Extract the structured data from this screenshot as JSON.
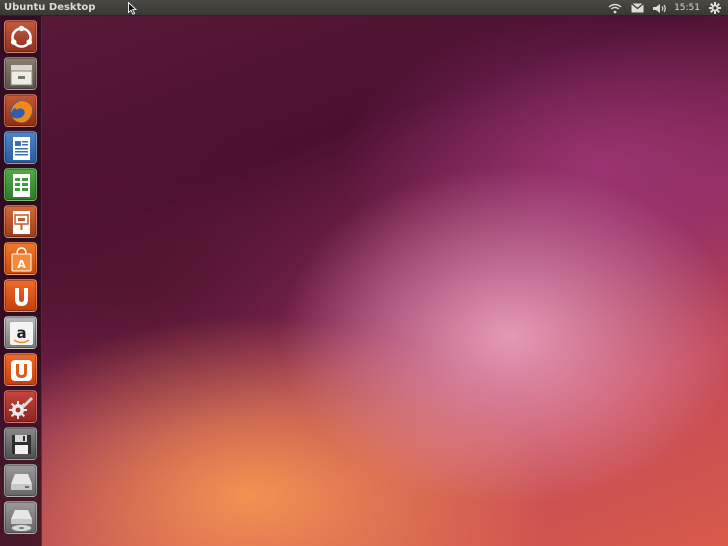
{
  "top_panel": {
    "title": "Ubuntu Desktop",
    "clock": "15:51",
    "indicators": [
      "wifi-icon",
      "mail-icon",
      "volume-icon",
      "gear-icon"
    ]
  },
  "launcher": {
    "items": [
      {
        "name": "dash-home",
        "icon": "ubuntu-logo-icon",
        "color": "#b0452f"
      },
      {
        "name": "files",
        "icon": "file-cabinet-icon",
        "color": "#7b6f63"
      },
      {
        "name": "firefox",
        "icon": "firefox-icon",
        "color": "#c0502a"
      },
      {
        "name": "libreoffice-writer",
        "icon": "writer-document-icon",
        "color": "#3a6fb0"
      },
      {
        "name": "libreoffice-calc",
        "icon": "calc-spreadsheet-icon",
        "color": "#3f9a3a"
      },
      {
        "name": "libreoffice-impress",
        "icon": "impress-presentation-icon",
        "color": "#c45b2a"
      },
      {
        "name": "software-center",
        "icon": "shopping-bag-icon",
        "color": "#e06a1e"
      },
      {
        "name": "ubuntu-one",
        "icon": "ubuntu-one-icon",
        "color": "#e4591e"
      },
      {
        "name": "amazon",
        "icon": "amazon-icon",
        "color": "#9a9a9a"
      },
      {
        "name": "ubuntu-one-music",
        "icon": "ubuntu-one-music-icon",
        "color": "#e05a1e"
      },
      {
        "name": "system-settings",
        "icon": "settings-tools-icon",
        "color": "#b6322e"
      },
      {
        "name": "floppy-drive",
        "icon": "floppy-disk-icon",
        "color": "#6d6d6d"
      },
      {
        "name": "storage-drive",
        "icon": "hard-drive-icon",
        "color": "#8a8a8a"
      },
      {
        "name": "optical-drive",
        "icon": "optical-disc-icon",
        "color": "#8a8a8a"
      }
    ]
  }
}
